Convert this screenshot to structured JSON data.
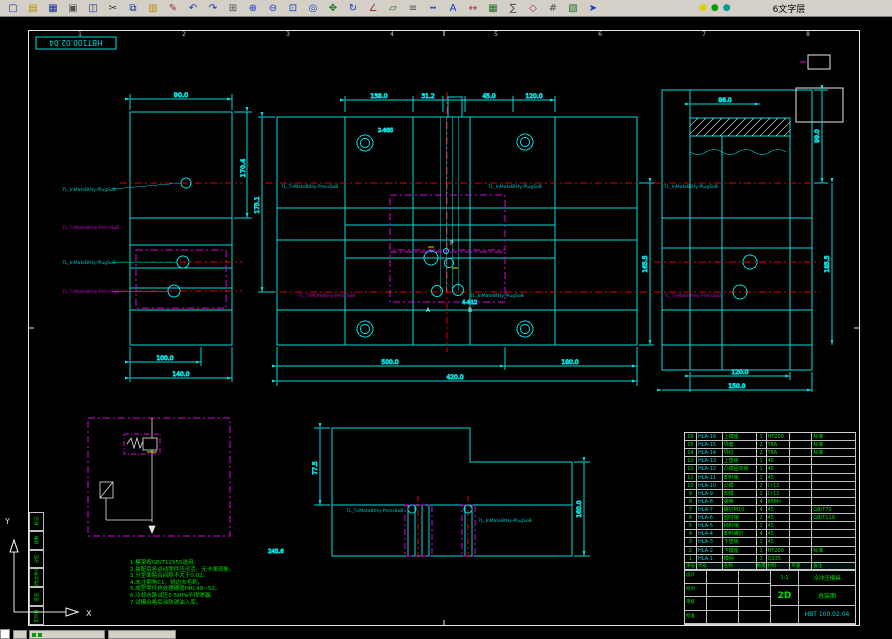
{
  "toolbar": {
    "layer_label": "6文字层",
    "icons": [
      {
        "name": "new-icon",
        "glyph": "▢",
        "color": "#16329c"
      },
      {
        "name": "open-icon",
        "glyph": "▤",
        "color": "#c08a00"
      },
      {
        "name": "save-icon",
        "glyph": "▦",
        "color": "#16329c"
      },
      {
        "name": "print-icon",
        "glyph": "▣",
        "color": "#505050"
      },
      {
        "name": "preview-icon",
        "glyph": "◫",
        "color": "#16329c"
      },
      {
        "name": "cut-icon",
        "glyph": "✂",
        "color": "#303030"
      },
      {
        "name": "copy-icon",
        "glyph": "⧉",
        "color": "#16329c"
      },
      {
        "name": "paste-icon",
        "glyph": "▥",
        "color": "#c08a00"
      },
      {
        "name": "format-brush-icon",
        "glyph": "✎",
        "color": "#a03030"
      },
      {
        "name": "undo-icon",
        "glyph": "↶",
        "color": "#1038c0"
      },
      {
        "name": "redo-icon",
        "glyph": "↷",
        "color": "#1038c0"
      },
      {
        "name": "insert-block-icon",
        "glyph": "⊞",
        "color": "#505050"
      },
      {
        "name": "zoom-in-icon",
        "glyph": "⊕",
        "color": "#1038c0"
      },
      {
        "name": "zoom-out-icon",
        "glyph": "⊖",
        "color": "#1038c0"
      },
      {
        "name": "zoom-window-icon",
        "glyph": "⊡",
        "color": "#1038c0"
      },
      {
        "name": "zoom-extents-icon",
        "glyph": "◎",
        "color": "#1038c0"
      },
      {
        "name": "pan-icon",
        "glyph": "✥",
        "color": "#207020"
      },
      {
        "name": "redraw-icon",
        "glyph": "↻",
        "color": "#1038c0"
      },
      {
        "name": "distance-icon",
        "glyph": "∠",
        "color": "#a03030"
      },
      {
        "name": "area-icon",
        "glyph": "▱",
        "color": "#207020"
      },
      {
        "name": "layers-icon",
        "glyph": "≡",
        "color": "#505050"
      },
      {
        "name": "linetype-icon",
        "glyph": "╍",
        "color": "#1038c0"
      },
      {
        "name": "text-icon",
        "glyph": "A",
        "color": "#1038c0"
      },
      {
        "name": "dimension-icon",
        "glyph": "↔",
        "color": "#a03030"
      },
      {
        "name": "table-icon",
        "glyph": "▦",
        "color": "#207020"
      },
      {
        "name": "calculator-icon",
        "glyph": "∑",
        "color": "#505050"
      },
      {
        "name": "osnap-icon",
        "glyph": "◇",
        "color": "#a03030"
      },
      {
        "name": "grid-icon",
        "glyph": "#",
        "color": "#505050"
      },
      {
        "name": "image-icon",
        "glyph": "▧",
        "color": "#207020"
      },
      {
        "name": "pointer-icon",
        "glyph": "➤",
        "color": "#1038c0"
      }
    ],
    "dots": [
      {
        "name": "layer-dot-yellow",
        "glyph": "●",
        "color": "#ddd000"
      },
      {
        "name": "layer-dot-green",
        "glyph": "●",
        "color": "#00a000"
      },
      {
        "name": "layer-dot-cyan",
        "glyph": "●",
        "color": "#009898"
      }
    ]
  },
  "frame": {
    "label": "HBT100.02.04",
    "zones_top": [
      "1",
      "2",
      "3",
      "4",
      "5",
      "6",
      "7",
      "8"
    ]
  },
  "axes": {
    "x": "X",
    "y": "Y"
  },
  "dims": {
    "lv": {
      "top": "90.0",
      "right": "170.4",
      "b1": "100.0",
      "b2": "140.0"
    },
    "cv": {
      "t1": "138.0",
      "t2": "31.2",
      "t3": "45.0",
      "t4": "120.0",
      "b1": "500.0",
      "b2": "180.0",
      "b3": "420.0",
      "l1": "175.1",
      "r1": "165.5",
      "hole1": "4-Φ12",
      "hole2": "2-Φ35"
    },
    "rv": {
      "t1": "86.0",
      "r1": "185.5",
      "r2": "99.0",
      "b1": "120.0",
      "b2": "150.0"
    },
    "bv": {
      "l1": "77.5",
      "r1": "160.0",
      "g1": "245.6"
    }
  },
  "labels": {
    "g1": "7L_InMateBtHy-PlugSoB",
    "g2": "7L_TnMateBtHy-PressSoB",
    "p": "P",
    "a": "A",
    "b": "B"
  },
  "notes": {
    "lines": [
      "1.模架按GB/T12555选用。",
      "2.装配后各运动零件应灵活、无卡滞现象。",
      "3.分型面贴合间隙不大于0.02。",
      "4.未注倒角C1，锐边去毛刺。",
      "5.成型零件热处理硬度HRC48~52。",
      "6.冷却水路试压0.5MPa不得渗漏。",
      "7.试模合格后涂防锈油入库。"
    ]
  },
  "rev_strip": {
    "items": [
      "标记",
      "处数",
      "分区",
      "更改文件号",
      "签名",
      "年月日"
    ]
  },
  "parts_table": {
    "headers": [
      "序号",
      "代号",
      "名称",
      "数量",
      "材料",
      "单重",
      "备注"
    ],
    "rows": [
      [
        "16",
        "HLA-16",
        "上模座",
        "1",
        "HT200",
        "",
        "标准"
      ],
      [
        "15",
        "HLA-15",
        "导套",
        "2",
        "T8A",
        "",
        "标准"
      ],
      [
        "14",
        "HLA-14",
        "导柱",
        "2",
        "T8A",
        "",
        "标准"
      ],
      [
        "13",
        "HLA-13",
        "上垫板",
        "1",
        "45",
        "",
        ""
      ],
      [
        "12",
        "HLA-12",
        "凸模固定板",
        "1",
        "45",
        "",
        ""
      ],
      [
        "11",
        "HLA-11",
        "卸料板",
        "1",
        "45",
        "",
        ""
      ],
      [
        "10",
        "HLA-10",
        "凸模",
        "2",
        "Cr12",
        "",
        ""
      ],
      [
        "9",
        "HLA-9",
        "凹模",
        "1",
        "Cr12",
        "",
        ""
      ],
      [
        "8",
        "HLA-8",
        "弹簧",
        "4",
        "65Mn",
        "",
        ""
      ],
      [
        "7",
        "HLA-7",
        "螺钉M10",
        "4",
        "45",
        "",
        "GB/T70"
      ],
      [
        "6",
        "HLA-6",
        "圆柱销",
        "2",
        "45",
        "",
        "GB/T119"
      ],
      [
        "5",
        "HLA-5",
        "挡料销",
        "1",
        "45",
        "",
        ""
      ],
      [
        "4",
        "HLA-4",
        "卸料螺钉",
        "4",
        "45",
        "",
        ""
      ],
      [
        "3",
        "HLA-3",
        "下垫板",
        "1",
        "45",
        "",
        ""
      ],
      [
        "2",
        "HLA-2",
        "下模座",
        "1",
        "HT200",
        "",
        "标准"
      ],
      [
        "1",
        "HLA-1",
        "模柄",
        "1",
        "Q235",
        "",
        ""
      ]
    ]
  },
  "title_block": {
    "rows": [
      [
        "设计",
        "",
        ""
      ],
      [
        "校对",
        "",
        ""
      ],
      [
        "审核",
        "",
        ""
      ],
      [
        "批准",
        "",
        ""
      ]
    ],
    "scale": "1:1",
    "format": "2D",
    "name1": "冷冲压模具",
    "name2": "总装图",
    "drawing_no": "HBT 100.02.04"
  }
}
